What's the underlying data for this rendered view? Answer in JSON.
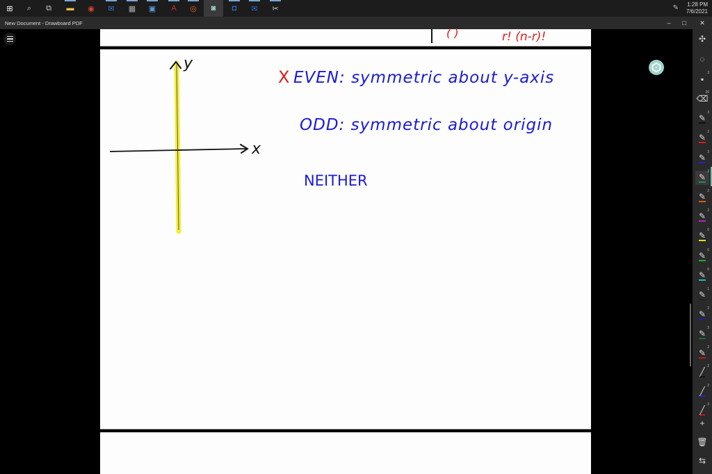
{
  "taskbar": {
    "apps": [
      {
        "name": "start",
        "glyph": "⊞"
      },
      {
        "name": "search",
        "glyph": "⌕"
      },
      {
        "name": "task-view",
        "glyph": "⧉"
      },
      {
        "name": "file-explorer",
        "glyph": "▬"
      },
      {
        "name": "chrome",
        "glyph": "◉"
      },
      {
        "name": "outlook",
        "glyph": "✉"
      },
      {
        "name": "calculator",
        "glyph": "▦"
      },
      {
        "name": "remote-desktop",
        "glyph": "▣"
      },
      {
        "name": "acrobat",
        "glyph": "A"
      },
      {
        "name": "ubuntu",
        "glyph": "◎"
      },
      {
        "name": "drawboard",
        "glyph": "◙"
      },
      {
        "name": "app-blue",
        "glyph": "◘"
      },
      {
        "name": "mail",
        "glyph": "✉"
      },
      {
        "name": "snipping",
        "glyph": "✂"
      }
    ],
    "tray": {
      "time": "1:28 PM",
      "date": "7/6/2021",
      "pen_icon": "✎"
    }
  },
  "window": {
    "title": "New Document - Drawboard PDF",
    "minimize": "–",
    "maximize": "□",
    "close": "✕"
  },
  "document": {
    "prev_page_fragment": "r! (n-r)!",
    "prev_page_fragment_left": "( )",
    "notes": {
      "even_mark": "X",
      "even": "EVEN: symmetric about y-axis",
      "odd": "ODD: symmetric about origin",
      "neither": "NEITHER"
    },
    "graph": {
      "x_label": "x",
      "y_label": "y"
    },
    "colors": {
      "ink_blue": "#1a1ad6",
      "ink_red": "#e01a1a",
      "highlighter": "#f2ee3a",
      "ink_black": "#111111"
    }
  },
  "toolbar": {
    "tools": [
      {
        "name": "ruler-tool",
        "glyph": "✣",
        "level": ""
      },
      {
        "name": "lasso-tool",
        "glyph": "◌",
        "level": ""
      },
      {
        "name": "shape-tool",
        "glyph": "▪",
        "level": "3"
      },
      {
        "name": "eraser-tool",
        "glyph": "⌫",
        "level": "26"
      },
      {
        "name": "pen-black",
        "glyph": "✎",
        "color": "#111111",
        "level": "3"
      },
      {
        "name": "pen-red",
        "glyph": "✎",
        "color": "#d02020",
        "level": "2"
      },
      {
        "name": "pen-blue",
        "glyph": "✎",
        "color": "#2020c0",
        "level": "3"
      },
      {
        "name": "pen-green-active",
        "glyph": "✎",
        "color": "#1f8f4f",
        "level": "2"
      },
      {
        "name": "pen-orange",
        "glyph": "✎",
        "color": "#d06010",
        "level": "2"
      },
      {
        "name": "pen-magenta",
        "glyph": "✎",
        "color": "#c020c0",
        "level": "2"
      },
      {
        "name": "pen-yellow",
        "glyph": "✎",
        "color": "#e0e020",
        "level": "6"
      },
      {
        "name": "pen-green",
        "glyph": "✎",
        "color": "#20b020",
        "level": "6"
      },
      {
        "name": "pen-teal",
        "glyph": "✎",
        "color": "#20c0b0",
        "level": "6"
      },
      {
        "name": "pen-dark",
        "glyph": "✎",
        "color": "#222222",
        "level": "1"
      },
      {
        "name": "pen-navy",
        "glyph": "✎",
        "color": "#2020a0",
        "level": "2"
      },
      {
        "name": "pen-darkgreen",
        "glyph": "✎",
        "color": "#107030",
        "level": "3"
      },
      {
        "name": "pen-red2",
        "glyph": "✎",
        "color": "#c01818",
        "level": "2"
      },
      {
        "name": "line-black",
        "glyph": "╱",
        "color": "#111111",
        "level": "2"
      },
      {
        "name": "line-blue",
        "glyph": "╱",
        "color": "#2020d0",
        "level": "2"
      },
      {
        "name": "line-red",
        "glyph": "╱",
        "color": "#c01818",
        "level": "3"
      },
      {
        "name": "add-tool",
        "glyph": "+",
        "level": ""
      },
      {
        "name": "delete-tool",
        "glyph": "🗑",
        "level": ""
      },
      {
        "name": "swap-tool",
        "glyph": "⇆",
        "level": ""
      }
    ]
  }
}
